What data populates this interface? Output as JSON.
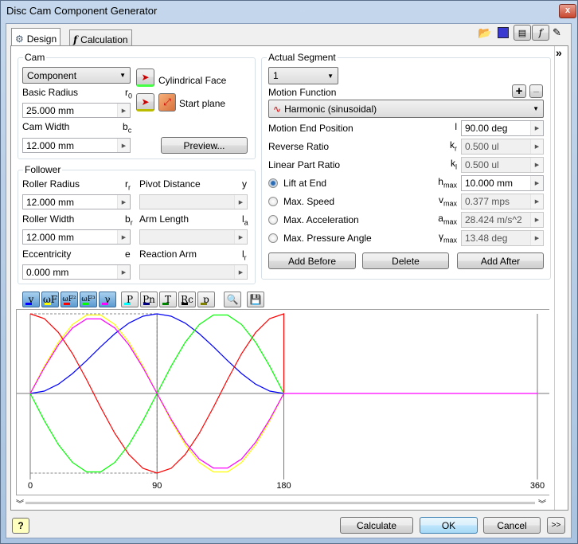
{
  "window": {
    "title": "Disc Cam Component Generator",
    "close": "x"
  },
  "tabs": [
    {
      "label": "Design",
      "icon": "gear-icon"
    },
    {
      "label": "Calculation",
      "icon": "function-icon"
    }
  ],
  "toolbar_icons": [
    "open-folder-icon",
    "save-icon",
    "design-guide-icon",
    "calc-function-icon",
    "notes-icon"
  ],
  "cam": {
    "group_label": "Cam",
    "type": "Component",
    "cylindrical_face": "Cylindrical Face",
    "start_plane": "Start plane",
    "basic_radius": {
      "label": "Basic Radius",
      "symbol": "r",
      "sub": "0",
      "value": "25.000 mm"
    },
    "cam_width": {
      "label": "Cam Width",
      "symbol": "b",
      "sub": "c",
      "value": "12.000 mm"
    },
    "preview": "Preview..."
  },
  "follower": {
    "group_label": "Follower",
    "fields": [
      {
        "label": "Roller Radius",
        "symbol": "r",
        "sub": "r",
        "value": "12.000 mm",
        "enabled": true
      },
      {
        "label": "Pivot Distance",
        "symbol": "y",
        "sub": "",
        "value": "",
        "enabled": false
      },
      {
        "label": "Roller Width",
        "symbol": "b",
        "sub": "r",
        "value": "12.000 mm",
        "enabled": true
      },
      {
        "label": "Arm Length",
        "symbol": "l",
        "sub": "a",
        "value": "",
        "enabled": false
      },
      {
        "label": "Eccentricity",
        "symbol": "e",
        "sub": "",
        "value": "0.000 mm",
        "enabled": true
      },
      {
        "label": "Reaction Arm",
        "symbol": "l",
        "sub": "r",
        "value": "",
        "enabled": false
      }
    ]
  },
  "segment": {
    "group_label": "Actual Segment",
    "selected": "1",
    "motion_function_label": "Motion Function",
    "motion_function": "Harmonic (sinusoidal)",
    "add": "+",
    "remove": "−",
    "rows": [
      {
        "label": "Motion End Position",
        "symbol": "l",
        "sub": "",
        "value": "90.00 deg",
        "enabled": true,
        "radio": null
      },
      {
        "label": "Reverse Ratio",
        "symbol": "k",
        "sub": "r",
        "value": "0.500 ul",
        "enabled": false,
        "radio": null
      },
      {
        "label": "Linear Part Ratio",
        "symbol": "k",
        "sub": "l",
        "value": "0.500 ul",
        "enabled": false,
        "radio": null
      },
      {
        "label": "Lift at End",
        "symbol": "h",
        "sub": "max",
        "value": "10.000 mm",
        "enabled": true,
        "radio": true
      },
      {
        "label": "Max. Speed",
        "symbol": "v",
        "sub": "max",
        "value": "0.377 mps",
        "enabled": false,
        "radio": false
      },
      {
        "label": "Max. Acceleration",
        "symbol": "a",
        "sub": "max",
        "value": "28.424 m/s^2",
        "enabled": false,
        "radio": false
      },
      {
        "label": "Max. Pressure Angle",
        "symbol": "γ",
        "sub": "max",
        "value": "13.48 deg",
        "enabled": false,
        "radio": false
      }
    ],
    "add_before": "Add Before",
    "delete": "Delete",
    "add_after": "Add After"
  },
  "chart_toolbar": [
    {
      "label": "y",
      "color": "#0000ff",
      "toggled": true
    },
    {
      "label": "ωF",
      "color": "#ffff00",
      "toggled": true
    },
    {
      "label": "ωF²",
      "color": "#ff0000",
      "toggled": true
    },
    {
      "label": "ωF³",
      "color": "#00ff00",
      "toggled": true
    },
    {
      "label": "γ",
      "color": "#ff00ff",
      "toggled": true
    },
    {
      "label": "P",
      "color": "#00ffff",
      "toggled": false
    },
    {
      "label": "Pn",
      "color": "#000080",
      "toggled": false
    },
    {
      "label": "T",
      "color": "#008000",
      "toggled": false
    },
    {
      "label": "Rc",
      "color": "#000000",
      "toggled": false
    },
    {
      "label": "p",
      "color": "#808000",
      "toggled": false
    },
    {
      "label": "🔍",
      "color": "",
      "toggled": false
    },
    {
      "label": "💾",
      "color": "",
      "toggled": false
    }
  ],
  "chart_data": {
    "type": "line",
    "xlim": [
      0,
      360
    ],
    "ylim": [
      -1,
      1
    ],
    "xticks": [
      "0",
      "90",
      "180",
      "360"
    ],
    "xtick_values": [
      0,
      90,
      180,
      360
    ],
    "highlighted_segment": [
      0,
      90
    ],
    "x": [
      0,
      10,
      20,
      30,
      40,
      50,
      60,
      70,
      80,
      90,
      100,
      110,
      120,
      130,
      140,
      150,
      160,
      170,
      180
    ],
    "series": [
      {
        "color": "#0000ff",
        "values": [
          0,
          0.03,
          0.117,
          0.25,
          0.413,
          0.587,
          0.75,
          0.883,
          0.97,
          1,
          0.97,
          0.883,
          0.75,
          0.587,
          0.413,
          0.25,
          0.117,
          0.03,
          0
        ]
      },
      {
        "color": "#ffff00",
        "values": [
          0,
          0.342,
          0.643,
          0.866,
          0.985,
          0.985,
          0.866,
          0.643,
          0.342,
          0,
          -0.342,
          -0.643,
          -0.866,
          -0.985,
          -0.985,
          -0.866,
          -0.643,
          -0.342,
          0
        ]
      },
      {
        "color": "#ff0000",
        "values": [
          1,
          0.94,
          0.766,
          0.5,
          0.174,
          -0.174,
          -0.5,
          -0.766,
          -0.94,
          -1,
          -0.94,
          -0.766,
          -0.5,
          -0.174,
          0.174,
          0.5,
          0.766,
          0.94,
          1
        ],
        "drop_to_zero_at_end": true
      },
      {
        "color": "#00ff00",
        "values": [
          0,
          -0.342,
          -0.643,
          -0.866,
          -0.985,
          -0.985,
          -0.866,
          -0.643,
          -0.342,
          0,
          0.342,
          0.643,
          0.866,
          0.985,
          0.985,
          0.866,
          0.643,
          0.342,
          0
        ]
      },
      {
        "color": "#ff00ff",
        "values": [
          0,
          0.325,
          0.611,
          0.823,
          0.936,
          0.936,
          0.823,
          0.611,
          0.325,
          0,
          -0.325,
          -0.611,
          -0.823,
          -0.936,
          -0.936,
          -0.823,
          -0.611,
          -0.325,
          0
        ],
        "extends_to": 360
      }
    ]
  },
  "footer": {
    "help": "?",
    "calculate": "Calculate",
    "ok": "OK",
    "cancel": "Cancel",
    "more": ">>"
  },
  "side": {
    "expand": "»"
  }
}
